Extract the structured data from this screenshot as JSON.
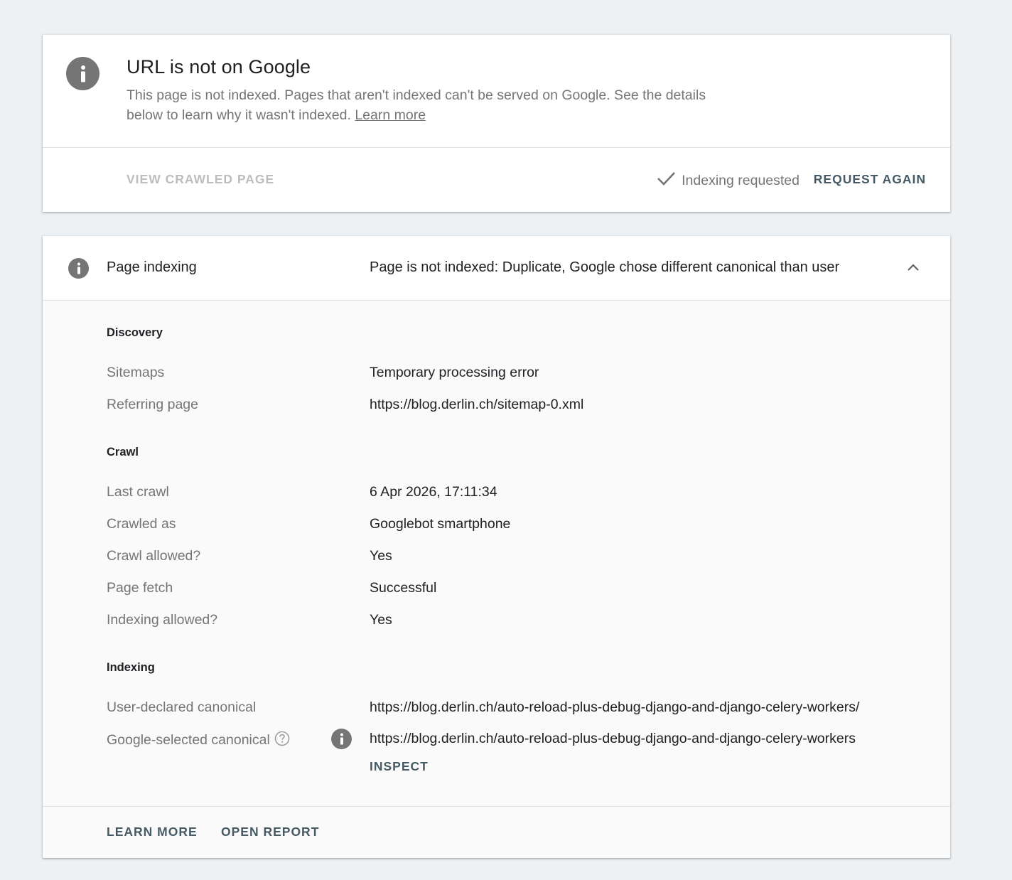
{
  "status": {
    "title": "URL is not on Google",
    "description": "This page is not indexed. Pages that aren't indexed can't be served on Google. See the details below to learn why it wasn't indexed.",
    "learn_more_link": "Learn more",
    "view_crawled_label": "VIEW CRAWLED PAGE",
    "indexing_requested": "Indexing requested",
    "request_again_label": "REQUEST AGAIN"
  },
  "indexing": {
    "title": "Page indexing",
    "summary": "Page is not indexed: Duplicate, Google chose different canonical than user",
    "discovery": {
      "title": "Discovery",
      "rows": [
        {
          "label": "Sitemaps",
          "value": "Temporary processing error"
        },
        {
          "label": "Referring page",
          "value": "https://blog.derlin.ch/sitemap-0.xml"
        }
      ]
    },
    "crawl": {
      "title": "Crawl",
      "rows": [
        {
          "label": "Last crawl",
          "value": "6 Apr 2026, 17:11:34"
        },
        {
          "label": "Crawled as",
          "value": "Googlebot smartphone"
        },
        {
          "label": "Crawl allowed?",
          "value": "Yes"
        },
        {
          "label": "Page fetch",
          "value": "Successful"
        },
        {
          "label": "Indexing allowed?",
          "value": "Yes"
        }
      ]
    },
    "indexing_section": {
      "title": "Indexing",
      "user_canonical_label": "User-declared canonical",
      "user_canonical_value": "https://blog.derlin.ch/auto-reload-plus-debug-django-and-django-celery-workers/",
      "google_canonical_label": "Google-selected canonical",
      "google_canonical_value": "https://blog.derlin.ch/auto-reload-plus-debug-django-and-django-celery-workers",
      "inspect_label": "INSPECT"
    },
    "footer": {
      "learn_more_label": "LEARN MORE",
      "open_report_label": "OPEN REPORT"
    }
  },
  "icons": {
    "status_icon": "info-icon",
    "check": "check-icon",
    "collapse": "chevron-up-icon",
    "help": "help-circle-icon"
  },
  "colors": {
    "accent_button": "#455a64",
    "muted_text": "#757575",
    "disabled_text": "#bdbdbd",
    "icon_fill": "#757575"
  }
}
